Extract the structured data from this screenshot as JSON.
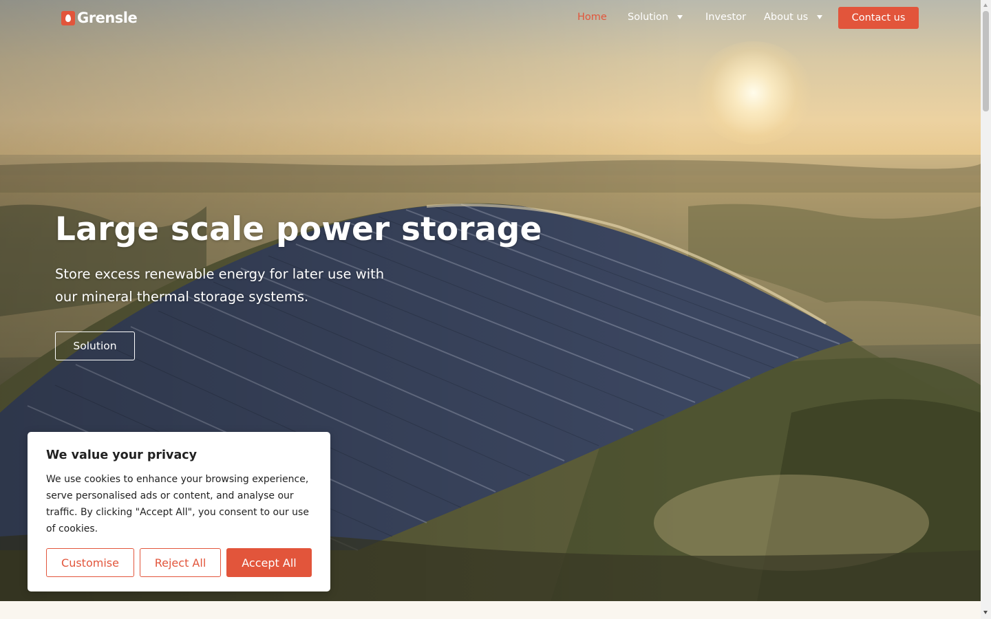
{
  "brand": {
    "name": "Grensle",
    "accent_color": "#e2553b"
  },
  "nav": {
    "items": [
      {
        "label": "Home",
        "active": true,
        "has_dropdown": false
      },
      {
        "label": "Solution",
        "active": false,
        "has_dropdown": true
      },
      {
        "label": "Investor",
        "active": false,
        "has_dropdown": false
      },
      {
        "label": "About us",
        "active": false,
        "has_dropdown": true
      }
    ],
    "contact_label": "Contact us"
  },
  "hero": {
    "title": "Large scale power storage",
    "subtitle_line1": "Store excess renewable energy for later use with",
    "subtitle_line2": "our mineral thermal storage systems.",
    "button_label": "Solution",
    "background_image": "aerial solar panel farm on hills at sunrise"
  },
  "cookie_banner": {
    "title": "We value your privacy",
    "text": "We use cookies to enhance your browsing experience, serve personalised ads or content, and analyse our traffic. By clicking \"Accept All\", you consent to our use of cookies.",
    "customise_label": "Customise",
    "reject_label": "Reject All",
    "accept_label": "Accept All"
  }
}
